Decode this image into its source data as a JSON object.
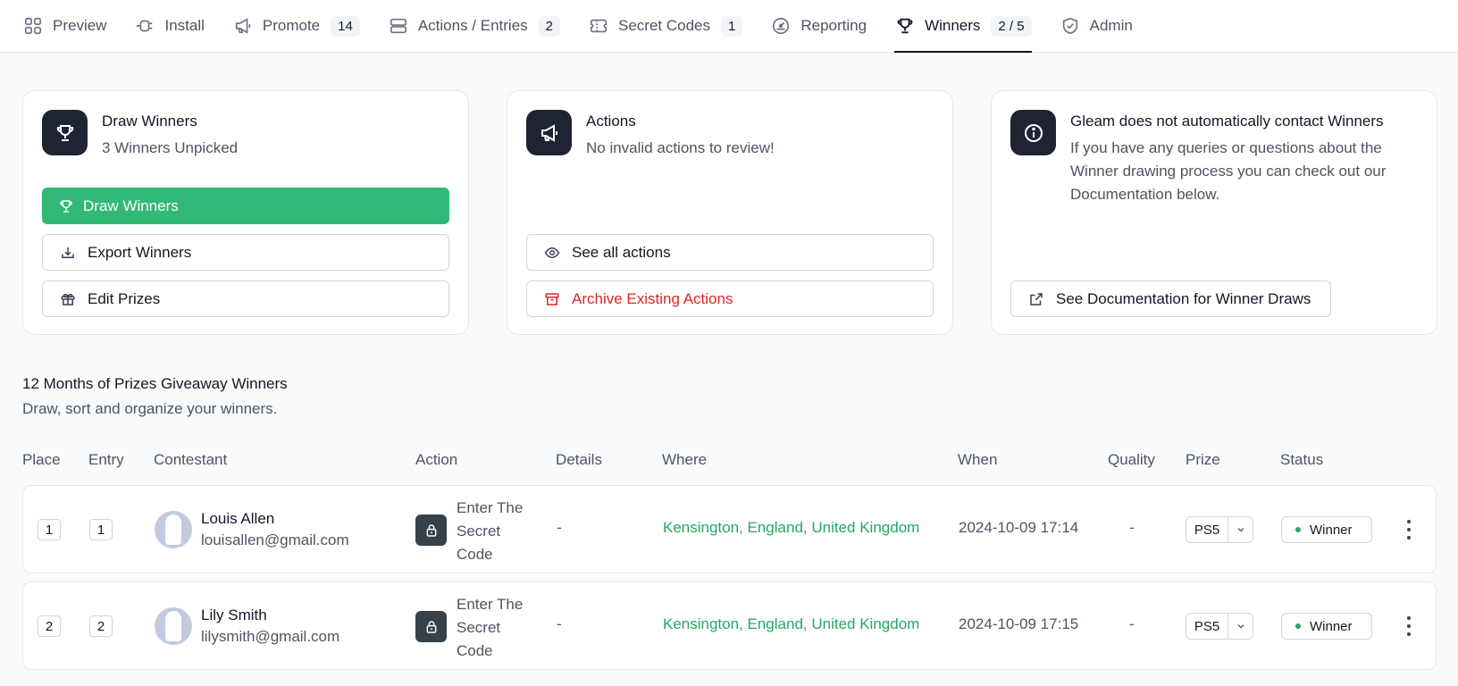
{
  "tabs": [
    {
      "label": "Preview",
      "icon": "grid-icon"
    },
    {
      "label": "Install",
      "icon": "plug-icon"
    },
    {
      "label": "Promote",
      "icon": "megaphone-icon",
      "badge": "14"
    },
    {
      "label": "Actions / Entries",
      "icon": "stack-icon",
      "badge": "2"
    },
    {
      "label": "Secret Codes",
      "icon": "ticket-icon",
      "badge": "1"
    },
    {
      "label": "Reporting",
      "icon": "gauge-icon"
    },
    {
      "label": "Winners",
      "icon": "trophy-icon",
      "badge": "2 / 5",
      "active": true
    },
    {
      "label": "Admin",
      "icon": "shield-check-icon"
    }
  ],
  "cards": {
    "draw": {
      "title": "Draw Winners",
      "subtitle": "3 Winners Unpicked",
      "draw_button": "Draw Winners",
      "export_button": "Export Winners",
      "edit_button": "Edit Prizes"
    },
    "actions": {
      "title": "Actions",
      "subtitle": "No invalid actions to review!",
      "see_button": "See all actions",
      "archive_button": "Archive Existing Actions"
    },
    "info": {
      "title": "Gleam does not automatically contact Winners",
      "subtitle": "If you have any queries or questions about the Winner drawing process you can check out our Documentation below.",
      "doc_button": "See Documentation for Winner Draws"
    }
  },
  "section": {
    "title": "12 Months of Prizes Giveaway Winners",
    "subtitle": "Draw, sort and organize your winners."
  },
  "table": {
    "headers": {
      "place": "Place",
      "entry": "Entry",
      "contestant": "Contestant",
      "action": "Action",
      "details": "Details",
      "where": "Where",
      "when": "When",
      "quality": "Quality",
      "prize": "Prize",
      "status": "Status"
    },
    "rows": [
      {
        "place": "1",
        "entry": "1",
        "name": "Louis Allen",
        "email": "louisallen@gmail.com",
        "action": "Enter The Secret Code",
        "details": "-",
        "where": "Kensington, England, United Kingdom",
        "when": "2024-10-09 17:14",
        "quality": "-",
        "prize": "PS5",
        "status": "Winner"
      },
      {
        "place": "2",
        "entry": "2",
        "name": "Lily Smith",
        "email": "lilysmith@gmail.com",
        "action": "Enter The Secret Code",
        "details": "-",
        "where": "Kensington, England, United Kingdom",
        "when": "2024-10-09 17:15",
        "quality": "-",
        "prize": "PS5",
        "status": "Winner"
      }
    ]
  },
  "colors": {
    "accent_green": "#32b876",
    "danger": "#dc2626",
    "icon_bg": "#1f2433"
  }
}
